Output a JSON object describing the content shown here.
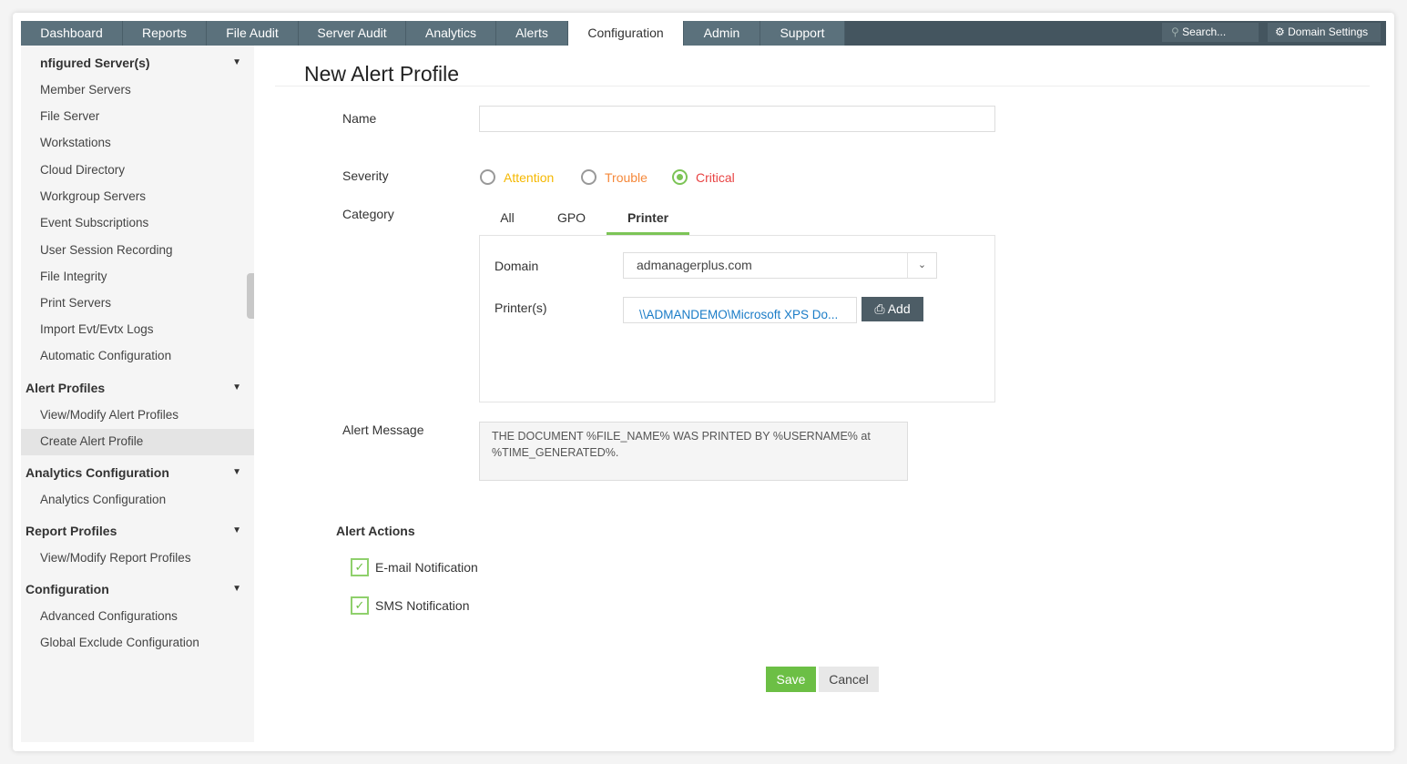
{
  "nav": {
    "tabs": [
      "Dashboard",
      "Reports",
      "File Audit",
      "Server Audit",
      "Analytics",
      "Alerts",
      "Configuration",
      "Admin",
      "Support"
    ],
    "active": "Configuration",
    "search_placeholder": "Search...",
    "domain_settings": "Domain Settings"
  },
  "sidebar": {
    "section0": "nfigured Server(s)",
    "items0": [
      "Member Servers",
      "File Server",
      "Workstations",
      "Cloud Directory",
      "Workgroup Servers",
      "Event Subscriptions",
      "User Session Recording",
      "File Integrity",
      "Print Servers",
      "Import Evt/Evtx Logs",
      "Automatic Configuration"
    ],
    "section1": "Alert Profiles",
    "items1": [
      "View/Modify Alert Profiles",
      "Create Alert Profile"
    ],
    "section2": "Analytics Configuration",
    "items2": [
      "Analytics Configuration"
    ],
    "section3": "Report Profiles",
    "items3": [
      "View/Modify Report Profiles"
    ],
    "section4": "Configuration",
    "items4": [
      "Advanced Configurations",
      "Global Exclude Configuration"
    ]
  },
  "form": {
    "title": "New Alert Profile",
    "name_label": "Name",
    "name_value": "",
    "severity_label": "Severity",
    "severity": [
      "Attention",
      "Trouble",
      "Critical"
    ],
    "severity_selected": "Critical",
    "severity_colors": {
      "Attention": "#f5b800",
      "Trouble": "#f5883a",
      "Critical": "#e84343"
    },
    "category_label": "Category",
    "category_tabs": [
      "All",
      "GPO",
      "Printer"
    ],
    "category_selected": "Printer",
    "domain_label": "Domain",
    "domain_value": "admanagerplus.com",
    "printers_label": "Printer(s)",
    "printer_value": "\\\\ADMANDEMO\\Microsoft XPS Do...",
    "add_label": "Add",
    "alert_message_label": "Alert Message",
    "alert_message": "THE DOCUMENT %FILE_NAME% WAS PRINTED BY %USERNAME% at %TIME_GENERATED%.",
    "alert_actions_label": "Alert Actions",
    "actions": [
      {
        "label": "E-mail Notification",
        "checked": true
      },
      {
        "label": "SMS Notification",
        "checked": true
      }
    ],
    "save": "Save",
    "cancel": "Cancel"
  }
}
